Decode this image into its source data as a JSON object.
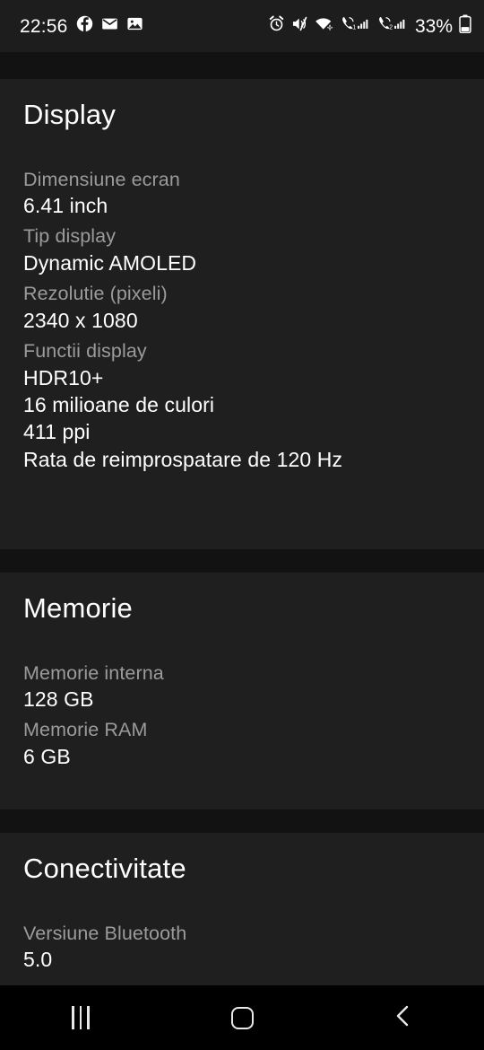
{
  "status_bar": {
    "clock": "22:56",
    "left_icons": [
      "facebook-icon",
      "email-icon",
      "gallery-icon"
    ],
    "right_icons": [
      "alarm-icon",
      "mute-icon",
      "wifi-icon",
      "sim1-signal-icon",
      "sim2-signal-icon"
    ],
    "battery_percent": "33%",
    "battery_level": 33
  },
  "sections": [
    {
      "title": "Display",
      "specs": [
        {
          "label": "Dimensiune ecran",
          "values": [
            "6.41 inch"
          ]
        },
        {
          "label": "Tip display",
          "values": [
            "Dynamic AMOLED"
          ]
        },
        {
          "label": "Rezolutie (pixeli)",
          "values": [
            "2340 x 1080"
          ]
        },
        {
          "label": "Functii display",
          "values": [
            "HDR10+",
            "16 milioane de culori",
            "411 ppi",
            "Rata de reimprospatare de 120 Hz"
          ]
        }
      ]
    },
    {
      "title": "Memorie",
      "specs": [
        {
          "label": "Memorie interna",
          "values": [
            "128 GB"
          ]
        },
        {
          "label": "Memorie RAM",
          "values": [
            "6 GB"
          ]
        }
      ]
    },
    {
      "title": "Conectivitate",
      "specs": [
        {
          "label": "Versiune Bluetooth",
          "values": [
            "5.0"
          ]
        }
      ]
    }
  ],
  "nav_bar": {
    "recents_label": "recents-button",
    "home_label": "home-button",
    "back_label": "back-button"
  },
  "colors": {
    "card_bg": "#1f1f1f",
    "band_bg": "#121212",
    "label": "#9b9b9b",
    "value": "#ffffff",
    "nav_bg": "#000000"
  }
}
